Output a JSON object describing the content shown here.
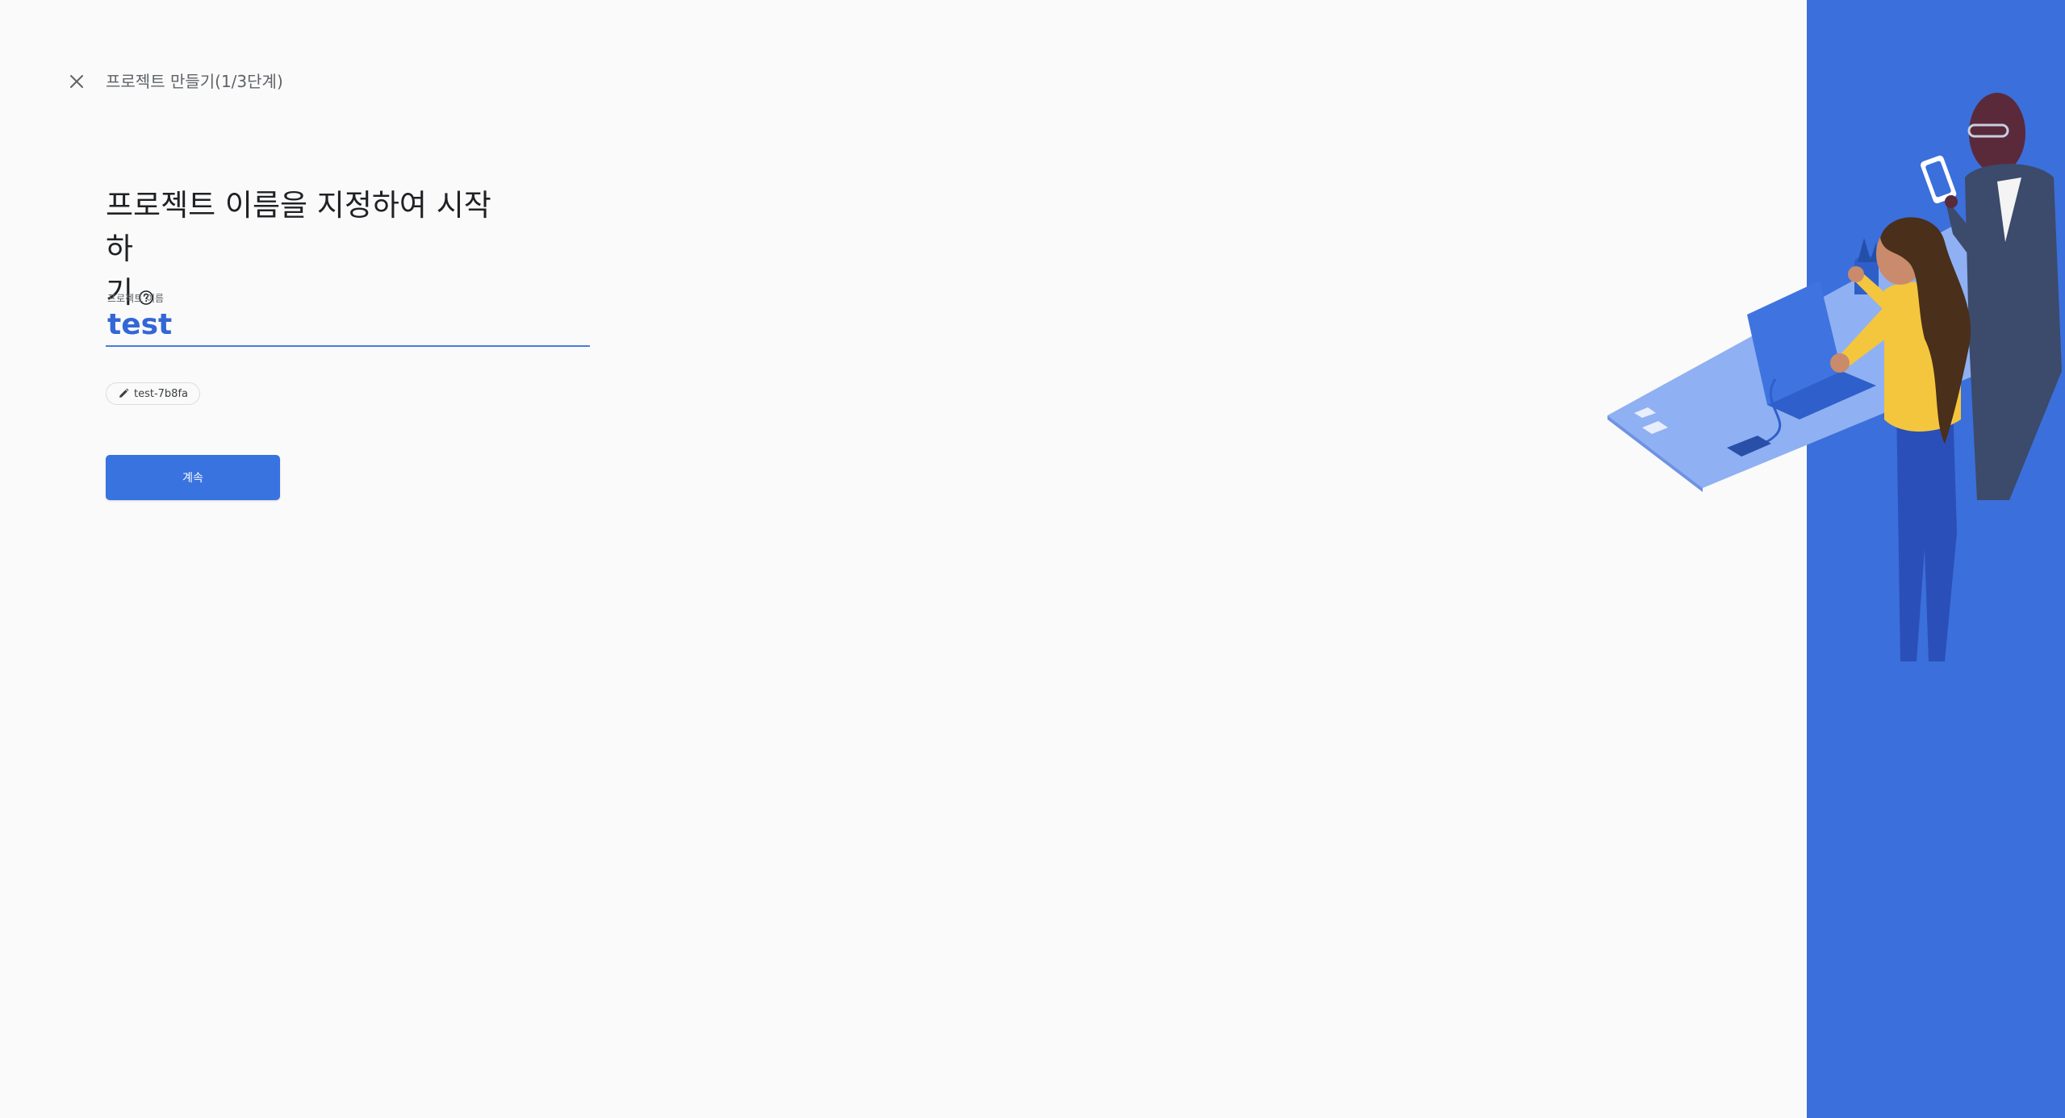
{
  "header": {
    "title": "프로젝트 만들기(1/3단계)",
    "close_icon": "close-icon"
  },
  "heading": {
    "line1": "프로젝트 이름을 지정하여 시작하",
    "line2": "기",
    "help_icon": "help-circle-icon"
  },
  "project_name": {
    "label": "프로젝트 이름",
    "value": "test"
  },
  "project_id_chip": {
    "icon": "pencil-icon",
    "text": "test-7b8fa"
  },
  "continue_button": {
    "label": "계속"
  },
  "colors": {
    "accent": "#3873e0",
    "input_text": "#3367d6",
    "panel": "#3b6fdb",
    "background": "#fafafa"
  }
}
